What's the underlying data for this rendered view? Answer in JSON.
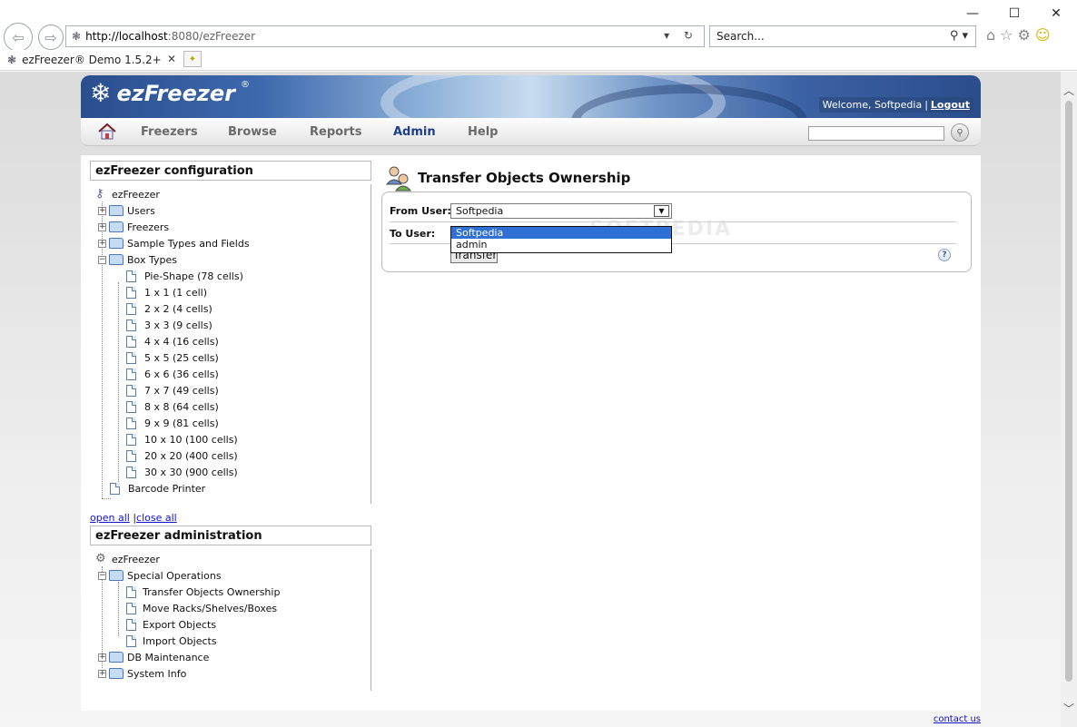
{
  "browser": {
    "url_host": "http://localhost",
    "url_rest": ":8080/ezFreezer",
    "search_placeholder": "Search...",
    "tab_title": "ezFreezer® Demo 1.5.2+",
    "win_min": "—",
    "win_max": "☐",
    "win_close": "✕"
  },
  "header": {
    "logo_text": "ezFreezer",
    "logo_reg": "®",
    "welcome_text": "Welcome, Softpedia",
    "separator": "|",
    "logout_label": "Logout"
  },
  "nav": {
    "items": [
      "Freezers",
      "Browse",
      "Reports",
      "Admin",
      "Help"
    ],
    "active": "Admin",
    "search_value": ""
  },
  "config": {
    "title": "ezFreezer configuration",
    "root": "ezFreezer",
    "items": [
      "Users",
      "Freezers",
      "Sample Types and Fields",
      "Box Types"
    ],
    "box_types": [
      "Pie-Shape (78 cells)",
      "1 x 1 (1 cell)",
      "2 x 2 (4 cells)",
      "3 x 3 (9 cells)",
      "4 x 4 (16 cells)",
      "5 x 5 (25 cells)",
      "6 x 6 (36 cells)",
      "7 x 7 (49 cells)",
      "8 x 8 (64 cells)",
      "9 x 9 (81 cells)",
      "10 x 10 (100 cells)",
      "20 x 20 (400 cells)",
      "30 x 30 (900 cells)"
    ],
    "barcode": "Barcode Printer"
  },
  "links": {
    "open_all": "open all",
    "sep": "|",
    "close_all": "close all"
  },
  "admin": {
    "title": "ezFreezer administration",
    "root": "ezFreezer",
    "special": "Special Operations",
    "special_items": [
      "Transfer Objects Ownership",
      "Move Racks/Shelves/Boxes",
      "Export Objects",
      "Import Objects"
    ],
    "db": "DB Maintenance",
    "sys": "System Info"
  },
  "transfer": {
    "title": "Transfer Objects Ownership",
    "from_label": "From User:",
    "from_value": "Softpedia",
    "to_label": "To User:",
    "options": [
      "Softpedia",
      "admin"
    ],
    "selected_option": "Softpedia",
    "button_label": "Transfer",
    "help": "?",
    "watermark": "SOFTPEDIA"
  },
  "footer": {
    "contact": "contact us"
  },
  "colors": {
    "active_nav": "#1d3f8b",
    "dropdown_selected": "#2f6fd6",
    "link": "#1111cc"
  }
}
